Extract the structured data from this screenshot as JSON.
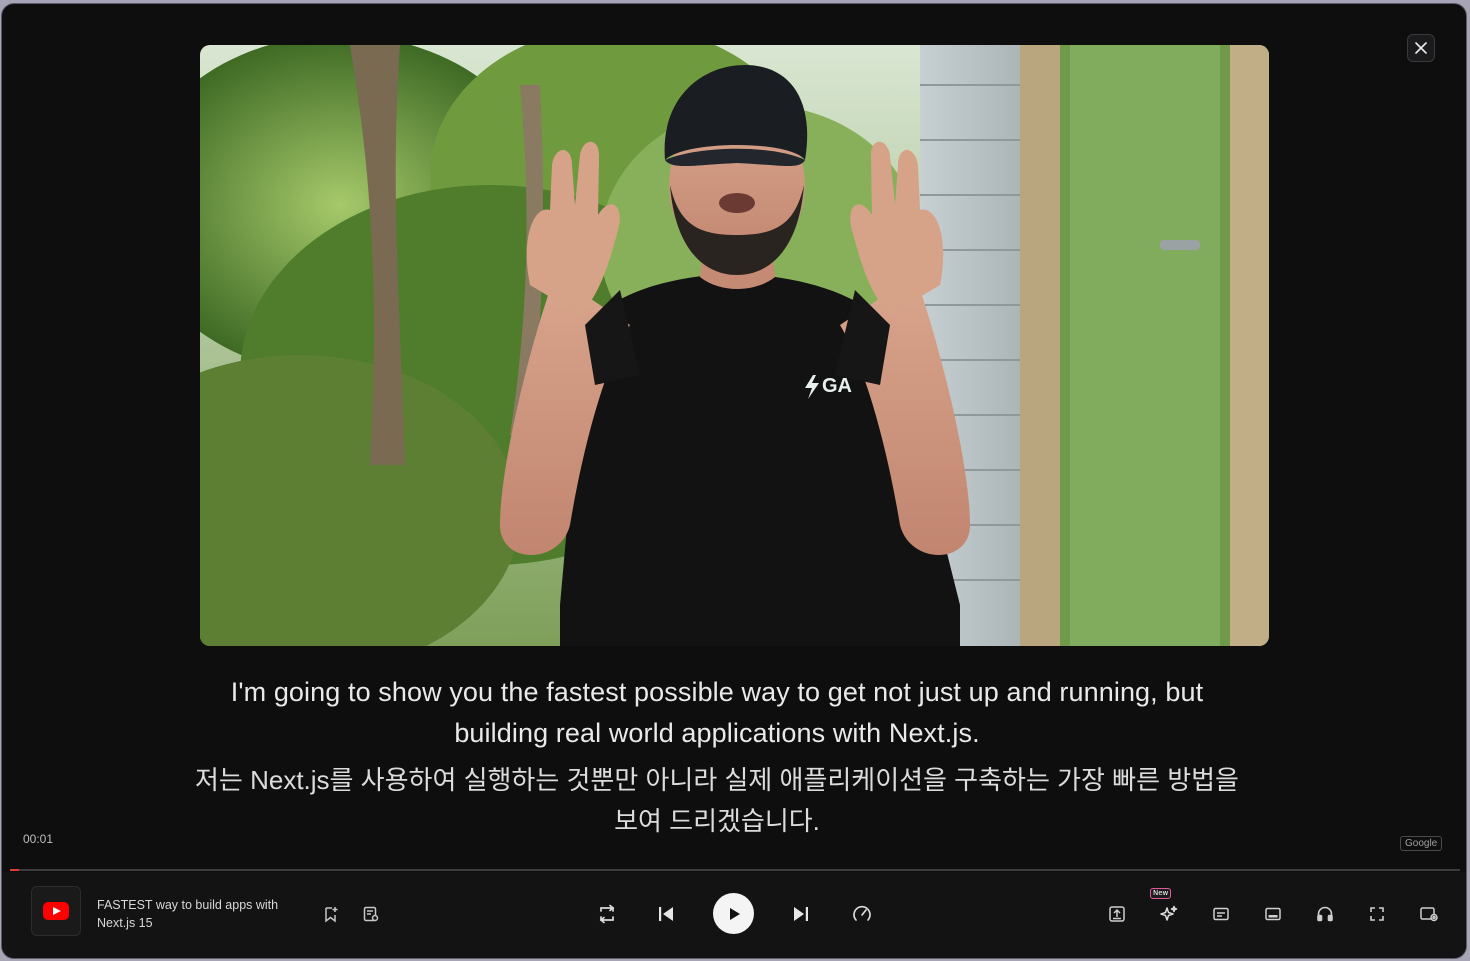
{
  "subtitles": {
    "english": "I'm going to show you the fastest possible way to get not just up and running, but building real world applications with Next.js.",
    "korean": "저는 Next.js를 사용하여 실행하는 것뿐만 아니라 실제 애플리케이션을 구축하는 가장 빠른 방법을 보여 드리겠습니다."
  },
  "player": {
    "timestamp": "00:01",
    "translation_badge": "Google",
    "progress": 0.006,
    "track_title": "FASTEST way to build apps with Next.js 15",
    "new_badge": "New",
    "shirt_logo": "GA"
  },
  "icons": {
    "close": "close-icon",
    "source_logo": "youtube-logo",
    "bookmark": "bookmark-add-icon",
    "playlist": "playlist-settings-icon",
    "repeat": "repeat-icon",
    "previous": "skip-previous-icon",
    "play": "play-icon",
    "next": "skip-next-icon",
    "speed": "playback-speed-icon",
    "export": "export-icon",
    "ai": "ai-sparkle-icon",
    "captions": "captions-icon",
    "subtitle_panel": "subtitle-panel-icon",
    "audio": "headphones-icon",
    "fullscreen": "fullscreen-icon",
    "display_settings": "display-settings-icon"
  },
  "colors": {
    "accent": "#e53935",
    "background": "#0e0e0f"
  }
}
